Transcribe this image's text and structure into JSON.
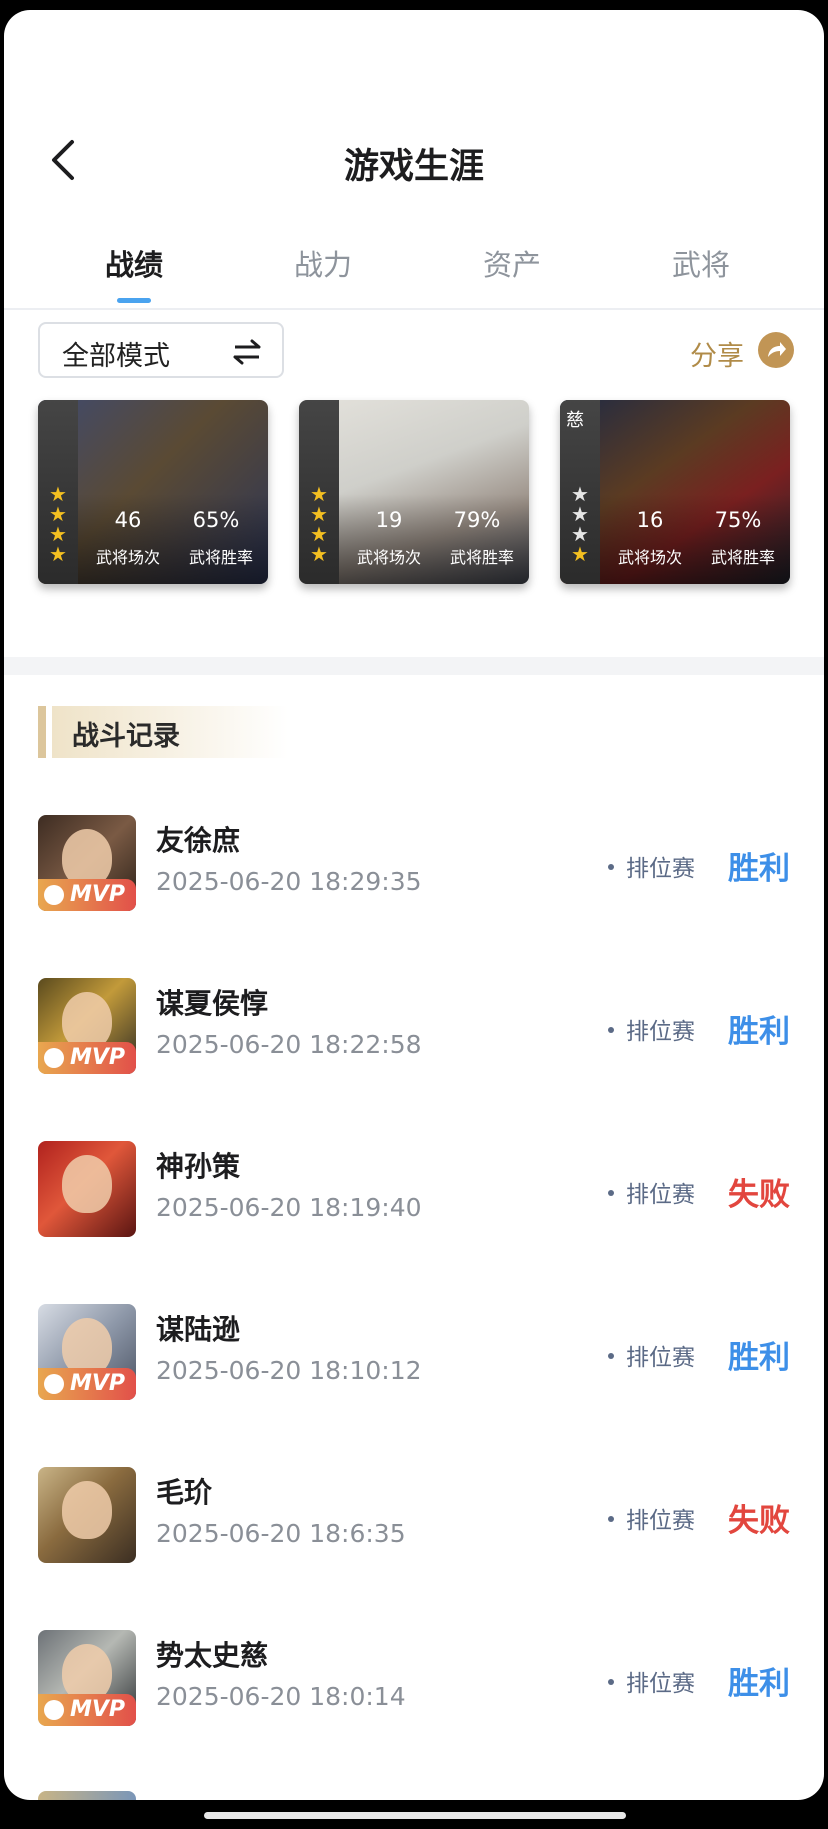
{
  "header": {
    "title": "游戏生涯"
  },
  "tabs": [
    {
      "label": "战绩",
      "active": true
    },
    {
      "label": "战力",
      "active": false
    },
    {
      "label": "资产",
      "active": false
    },
    {
      "label": "武将",
      "active": false
    }
  ],
  "filter": {
    "mode_label": "全部模式",
    "share_label": "分享"
  },
  "colors": {
    "accent": "#4aa3ef",
    "win": "#3d8fe8",
    "loss": "#e2463e",
    "share": "#b08b48"
  },
  "hero_cards": [
    {
      "tag": "",
      "stars": 4,
      "stars_total": 4,
      "matches": "46",
      "matches_label": "武将场次",
      "winrate": "65%",
      "winrate_label": "武将胜率"
    },
    {
      "tag": "",
      "stars": 4,
      "stars_total": 4,
      "matches": "19",
      "matches_label": "武将场次",
      "winrate": "79%",
      "winrate_label": "武将胜率"
    },
    {
      "tag": "慈",
      "stars": 1,
      "stars_total": 4,
      "matches": "16",
      "matches_label": "武将场次",
      "winrate": "75%",
      "winrate_label": "武将胜率"
    }
  ],
  "section": {
    "title": "战斗记录"
  },
  "records": [
    {
      "name": "友徐庶",
      "time": "2025-06-20 18:29:35",
      "mode": "排位赛",
      "result": "胜利",
      "win": true,
      "mvp": true,
      "mvp_label": "MVP"
    },
    {
      "name": "谋夏侯惇",
      "time": "2025-06-20 18:22:58",
      "mode": "排位赛",
      "result": "胜利",
      "win": true,
      "mvp": true,
      "mvp_label": "MVP"
    },
    {
      "name": "神孙策",
      "time": "2025-06-20 18:19:40",
      "mode": "排位赛",
      "result": "失败",
      "win": false,
      "mvp": false,
      "mvp_label": ""
    },
    {
      "name": "谋陆逊",
      "time": "2025-06-20 18:10:12",
      "mode": "排位赛",
      "result": "胜利",
      "win": true,
      "mvp": true,
      "mvp_label": "MVP"
    },
    {
      "name": "毛玠",
      "time": "2025-06-20 18:6:35",
      "mode": "排位赛",
      "result": "失败",
      "win": false,
      "mvp": false,
      "mvp_label": ""
    },
    {
      "name": "势太史慈",
      "time": "2025-06-20 18:0:14",
      "mode": "排位赛",
      "result": "胜利",
      "win": true,
      "mvp": true,
      "mvp_label": "MVP"
    }
  ]
}
